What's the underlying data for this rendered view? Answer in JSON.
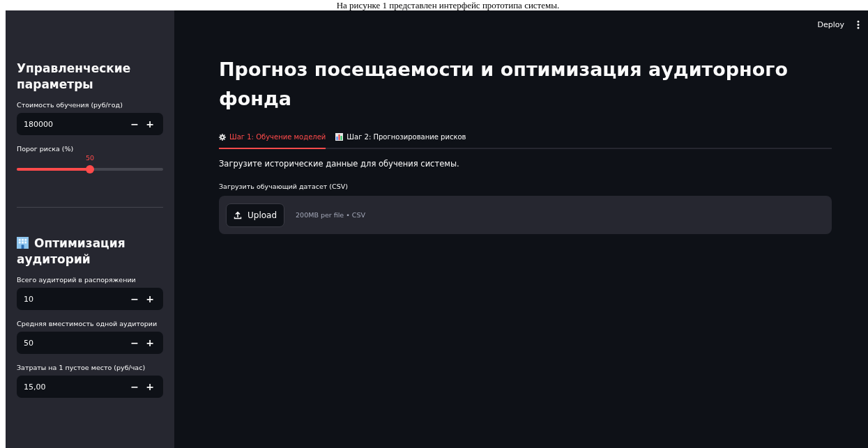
{
  "caption": "На рисунке 1 представлен интерфейс прототипа системы.",
  "header": {
    "deploy": "Deploy"
  },
  "sidebar": {
    "sections": [
      {
        "title": "Управленческие параметры",
        "controls": [
          {
            "kind": "number",
            "label": "Стоимость обучения (руб/год)",
            "value": "180000",
            "minus": "−",
            "plus": "+"
          },
          {
            "kind": "slider",
            "label": "Порог риска (%)",
            "reading": "50",
            "level": 0.5
          }
        ]
      },
      {
        "title": "Оптимизация аудиторий",
        "controls": [
          {
            "kind": "number",
            "label": "Всего аудиторий в распоряжении",
            "value": "10",
            "minus": "−",
            "plus": "+"
          },
          {
            "kind": "number",
            "label": "Средняя вместимость одной аудитории",
            "value": "50",
            "minus": "−",
            "plus": "+"
          },
          {
            "kind": "number",
            "label": "Затраты на 1 пустое место (руб/час)",
            "value": "15,00",
            "minus": "−",
            "plus": "+"
          }
        ]
      }
    ]
  },
  "main": {
    "title": "Прогноз посещаемости и оптимизация аудиторного фонда",
    "tabs": [
      {
        "label": "Шаг 1: Обучение моделей",
        "selected": true
      },
      {
        "label": "Шаг 2: Прогнозирование рисков",
        "selected": false
      }
    ],
    "intro": "Загрузите исторические данные для обучения системы.",
    "uploader": {
      "label": "Загрузить обучающий датасет (CSV)",
      "button": "Upload",
      "hint": "200MB per file • CSV"
    }
  }
}
